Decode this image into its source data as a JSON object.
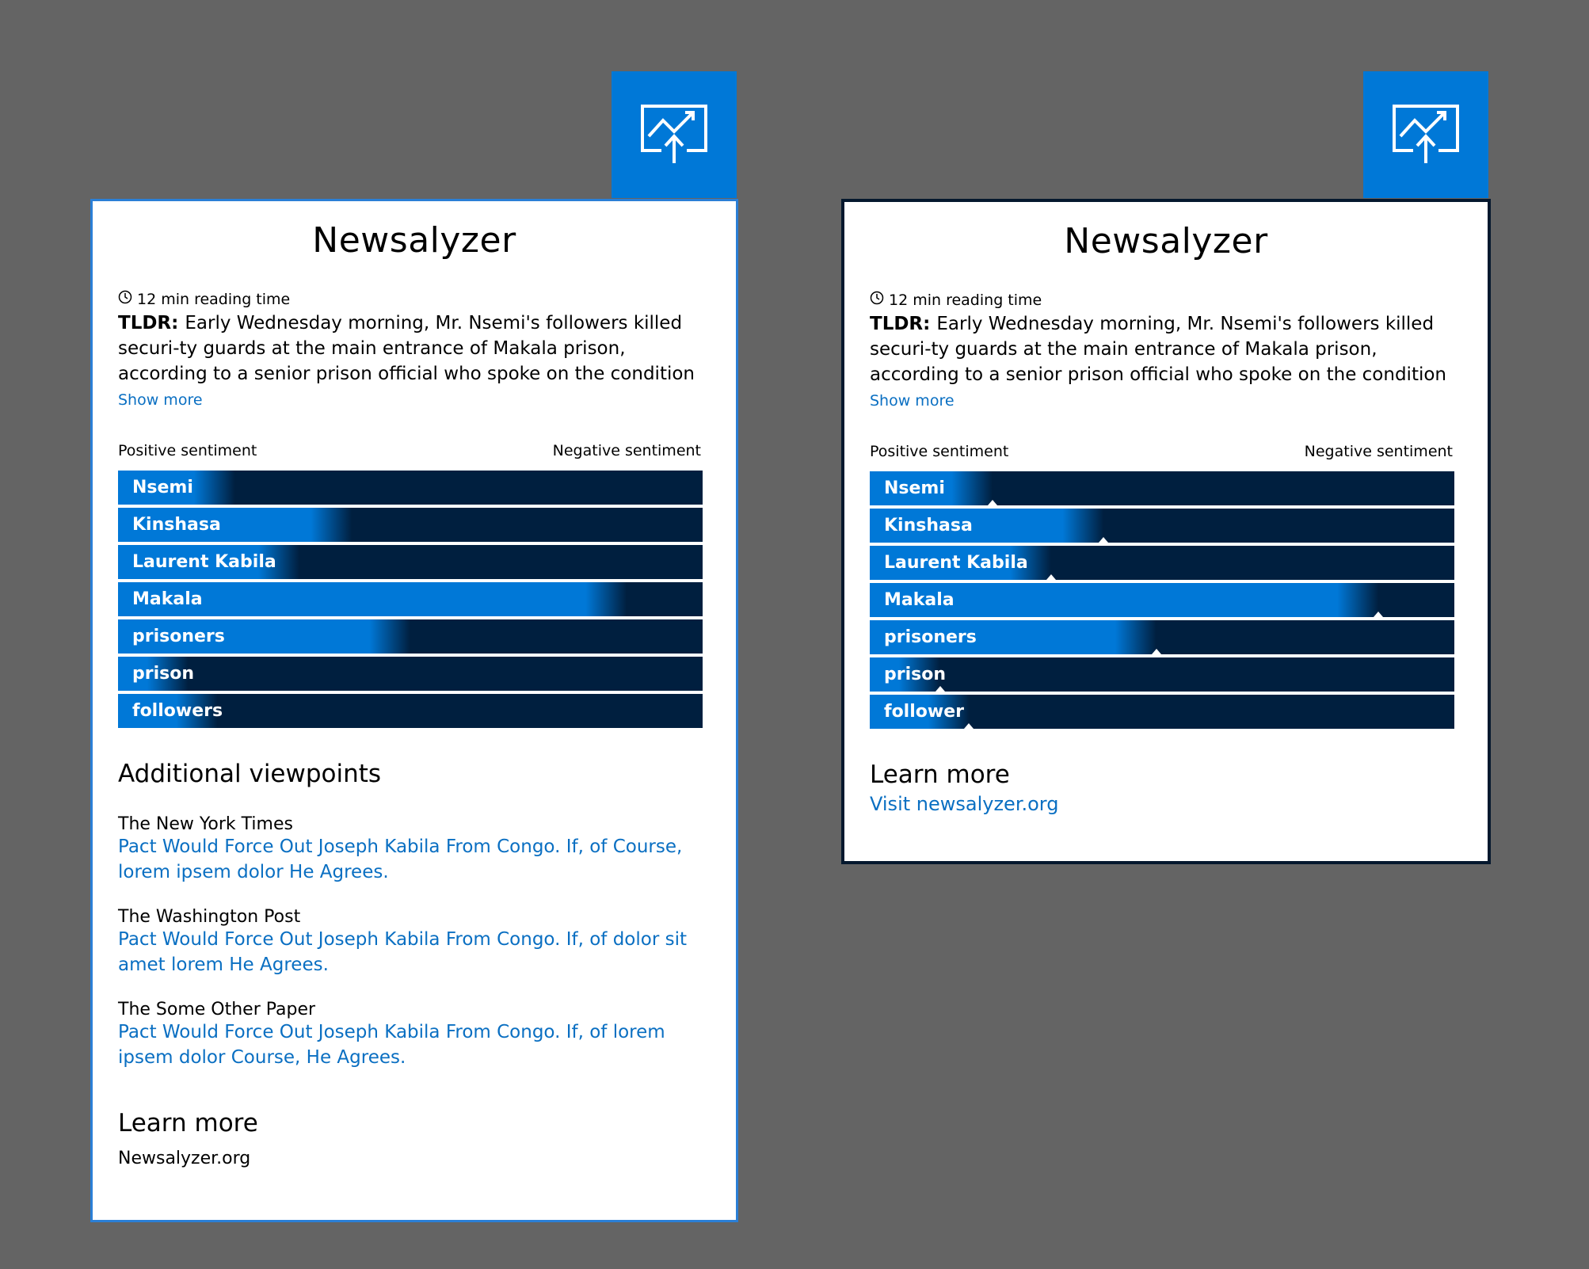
{
  "colors": {
    "accent": "#0078d7",
    "bar_dark": "#001f3f",
    "link": "#0a6fc2",
    "background": "#646464"
  },
  "badge_icon": "chart-upload-icon",
  "card1": {
    "title": "Newsalyzer",
    "reading_time": "12 min reading time",
    "tldr_label": "TLDR:",
    "tldr_text": "Early Wednesday morning, Mr. Nsemi's followers killed securi-ty guards at the main entrance of Makala prison, according to a senior prison official who spoke on the condition of anonymity be",
    "show_more": "Show more",
    "positive_label": "Positive sentiment",
    "negative_label": "Negative sentiment",
    "sentiments": [
      {
        "term": "Nsemi",
        "positive_share": 0.2
      },
      {
        "term": "Kinshasa",
        "positive_share": 0.4
      },
      {
        "term": "Laurent Kabila",
        "positive_share": 0.31
      },
      {
        "term": "Makala",
        "positive_share": 0.87
      },
      {
        "term": "prisoners",
        "positive_share": 0.5
      },
      {
        "term": "prison",
        "positive_share": 0.12
      },
      {
        "term": "followers",
        "positive_share": 0.17
      }
    ],
    "additional_title": "Additional viewpoints",
    "viewpoints": [
      {
        "source": "The New York Times",
        "headline": "Pact Would Force Out Joseph Kabila From Congo. If, of Course, lorem ipsem dolor He Agrees."
      },
      {
        "source": "The Washington Post",
        "headline": "Pact Would Force Out Joseph Kabila From Congo. If, of dolor sit amet lorem He Agrees."
      },
      {
        "source": "The Some Other Paper",
        "headline": "Pact Would Force Out Joseph Kabila From Congo. If, of lorem ipsem dolor Course, He Agrees."
      }
    ],
    "learn_more_title": "Learn more",
    "learn_more_text": "Newsalyzer.org"
  },
  "card2": {
    "title": "Newsalyzer",
    "reading_time": "12 min reading time",
    "tldr_label": "TLDR:",
    "tldr_text": "Early Wednesday morning, Mr. Nsemi's followers killed securi-ty guards at the main entrance of Makala prison, according to a senior prison official who spoke on the condition of anonymity be",
    "show_more": "Show more",
    "positive_label": "Positive sentiment",
    "negative_label": "Negative sentiment",
    "sentiments": [
      {
        "term": "Nsemi",
        "positive_share": 0.21
      },
      {
        "term": "Kinshasa",
        "positive_share": 0.4
      },
      {
        "term": "Laurent Kabila",
        "positive_share": 0.31
      },
      {
        "term": "Makala",
        "positive_share": 0.87
      },
      {
        "term": "prisoners",
        "positive_share": 0.49
      },
      {
        "term": "prison",
        "positive_share": 0.12
      },
      {
        "term": "follower",
        "positive_share": 0.17
      }
    ],
    "learn_more_title": "Learn more",
    "learn_more_link": "Visit newsalyzer.org"
  }
}
